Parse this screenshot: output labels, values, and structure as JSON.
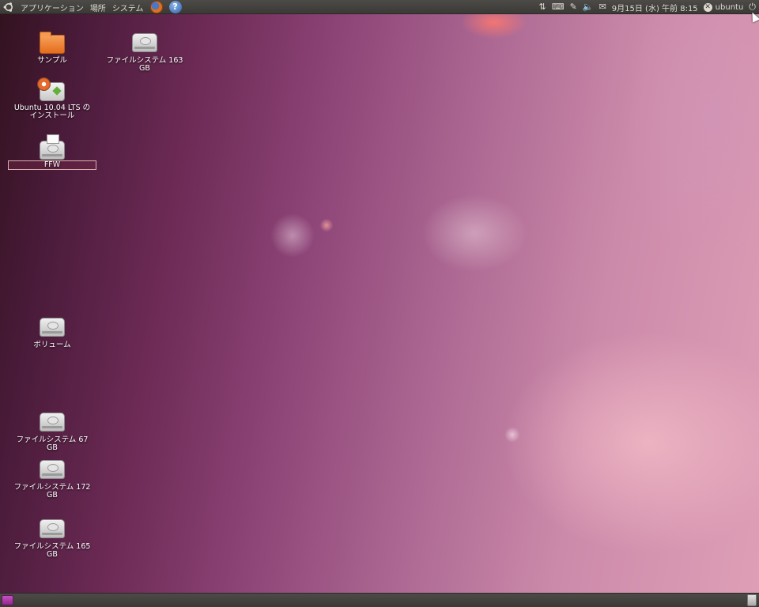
{
  "top_panel": {
    "menus": [
      "アプリケーション",
      "場所",
      "システム"
    ],
    "launchers": [
      {
        "icon": "firefox-icon"
      },
      {
        "icon": "help-icon",
        "glyph": "?"
      }
    ],
    "tray": {
      "network_icon": "⇅",
      "keyboard_icon": "⌨",
      "update_icon": "✎",
      "volume_icon": "🔈",
      "mail_icon": "✉",
      "clock": "9月15日 (水) 午前 8:15",
      "user_status_glyph": "✕",
      "user": "ubuntu",
      "power_icon": "⏻"
    }
  },
  "desktop": {
    "icons": [
      {
        "label": "サンプル"
      },
      {
        "label": "ファイルシステム 163 GB"
      },
      {
        "label": "Ubuntu 10.04 LTS の インストール"
      },
      {
        "label": "FFW"
      },
      {
        "label": "ボリューム"
      },
      {
        "label": "ファイルシステム 67 GB"
      },
      {
        "label": "ファイルシステム 172 GB"
      },
      {
        "label": "ファイルシステム 165 GB"
      }
    ]
  },
  "colors": {
    "panel": "#3b3a36",
    "panel_text": "#dfdbd2",
    "folder": "#e46d1c",
    "wallpaper_dark": "#32121f",
    "wallpaper_light": "#de9fb6"
  }
}
